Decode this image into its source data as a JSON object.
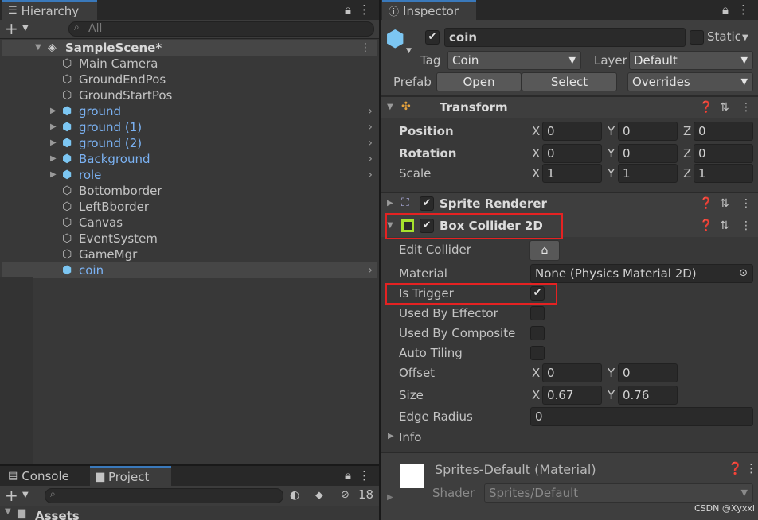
{
  "hierarchy": {
    "tab": "Hierarchy",
    "search_placeholder": "All",
    "scene": "SampleScene*",
    "items": [
      {
        "name": "Main Camera",
        "prefab": false
      },
      {
        "name": "GroundEndPos",
        "prefab": false
      },
      {
        "name": "GroundStartPos",
        "prefab": false
      },
      {
        "name": "ground",
        "prefab": true
      },
      {
        "name": "ground (1)",
        "prefab": true
      },
      {
        "name": "ground (2)",
        "prefab": true
      },
      {
        "name": "Background",
        "prefab": true
      },
      {
        "name": "role",
        "prefab": true
      },
      {
        "name": "Bottomborder",
        "prefab": false
      },
      {
        "name": "LeftBborder",
        "prefab": false
      },
      {
        "name": "Canvas",
        "prefab": false
      },
      {
        "name": "EventSystem",
        "prefab": false
      },
      {
        "name": "GameMgr",
        "prefab": false
      },
      {
        "name": "coin",
        "prefab": true
      }
    ]
  },
  "bottom_panel": {
    "tab_console": "Console",
    "tab_project": "Project",
    "hidden_count": "18",
    "assets_label": "Assets"
  },
  "inspector": {
    "tab": "Inspector",
    "object_name": "coin",
    "static_label": "Static",
    "tag_label": "Tag",
    "tag_value": "Coin",
    "layer_label": "Layer",
    "layer_value": "Default",
    "prefab_label": "Prefab",
    "open_label": "Open",
    "select_label": "Select",
    "overrides_label": "Overrides",
    "transform": {
      "title": "Transform",
      "position_label": "Position",
      "rotation_label": "Rotation",
      "scale_label": "Scale",
      "position": {
        "x": "0",
        "y": "0",
        "z": "0"
      },
      "rotation": {
        "x": "0",
        "y": "0",
        "z": "0"
      },
      "scale": {
        "x": "1",
        "y": "1",
        "z": "1"
      }
    },
    "sprite_renderer": {
      "title": "Sprite Renderer"
    },
    "box_collider": {
      "title": "Box Collider 2D",
      "edit_collider_label": "Edit Collider",
      "material_label": "Material",
      "material_value": "None (Physics Material 2D)",
      "is_trigger_label": "Is Trigger",
      "used_by_effector_label": "Used By Effector",
      "used_by_composite_label": "Used By Composite",
      "auto_tiling_label": "Auto Tiling",
      "offset_label": "Offset",
      "offset": {
        "x": "0",
        "y": "0"
      },
      "size_label": "Size",
      "size": {
        "x": "0.67",
        "y": "0.76"
      },
      "edge_radius_label": "Edge Radius",
      "edge_radius": "0",
      "info_label": "Info"
    },
    "material_section": {
      "name": "Sprites-Default (Material)",
      "shader_label": "Shader",
      "shader_value": "Sprites/Default"
    },
    "axis": {
      "x": "X",
      "y": "Y",
      "z": "Z"
    },
    "watermark": "CSDN @Xyxxi"
  },
  "colors": {
    "accent": "#3a79bb",
    "highlight_box": "#e52222",
    "prefab_blue": "#7bb2f3",
    "collider_green": "#a6e22e"
  }
}
